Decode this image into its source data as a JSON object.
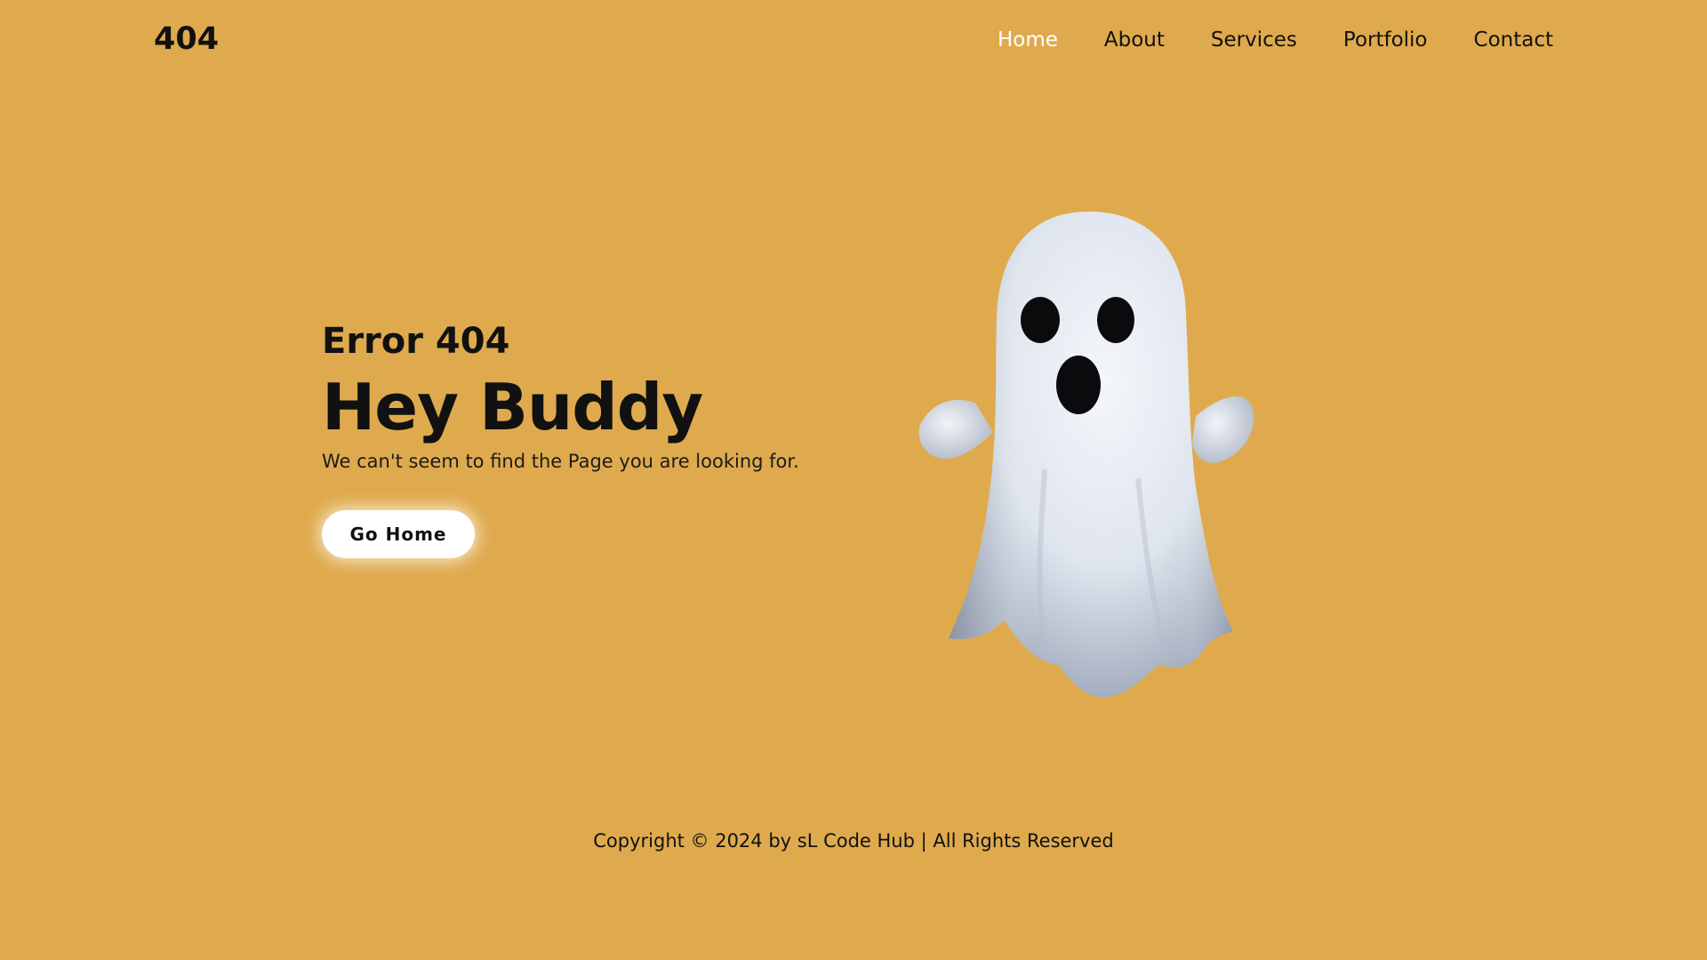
{
  "header": {
    "logo": "404",
    "nav": [
      "Home",
      "About",
      "Services",
      "Portfolio",
      "Contact"
    ],
    "active_nav": "Home"
  },
  "hero": {
    "error_code": "Error 404",
    "headline": "Hey Buddy",
    "message": "We can't seem to find the Page you are looking for.",
    "button_label": "Go Home"
  },
  "illustration": {
    "icon": "ghost-icon"
  },
  "footer": {
    "copyright": "Copyright © 2024 by sL Code Hub | All Rights Reserved"
  },
  "colors": {
    "background": "#dfaa4d",
    "text": "#111111",
    "active_nav": "#ffffff",
    "button_bg": "#ffffff"
  }
}
